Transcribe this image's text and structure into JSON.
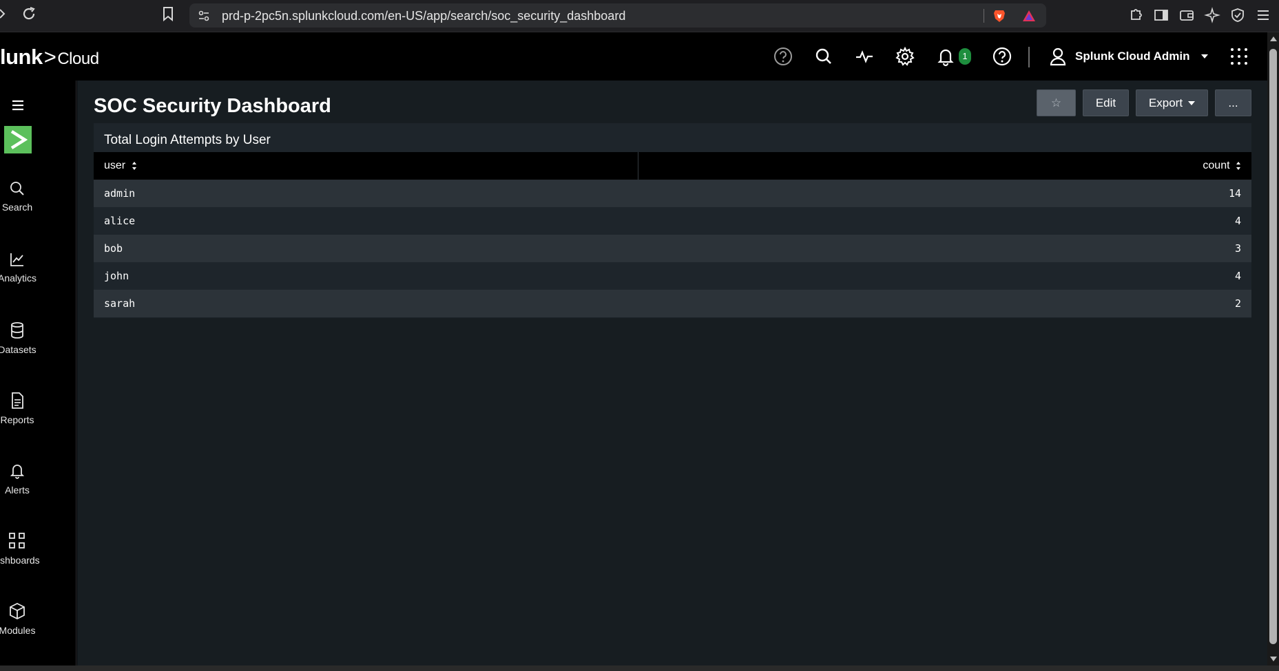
{
  "browser": {
    "url": "prd-p-2pc5n.splunkcloud.com/en-US/app/search/soc_security_dashboard"
  },
  "header": {
    "brand_main": "lunk",
    "brand_sep": ">",
    "brand_sub": "Cloud",
    "notification_count": "1",
    "user_name": "Splunk Cloud Admin"
  },
  "sidebar": {
    "items": [
      {
        "label": "Search",
        "icon": "search-icon"
      },
      {
        "label": "Analytics",
        "icon": "chart-icon"
      },
      {
        "label": "Datasets",
        "icon": "database-icon"
      },
      {
        "label": "Reports",
        "icon": "document-icon"
      },
      {
        "label": "Alerts",
        "icon": "bell-icon"
      },
      {
        "label": "ashboards",
        "icon": "dashboard-grid-icon"
      },
      {
        "label": "Modules",
        "icon": "cube-icon"
      }
    ]
  },
  "dashboard": {
    "title": "SOC Security Dashboard",
    "star_label": "☆",
    "edit_label": "Edit",
    "export_label": "Export",
    "more_label": "...",
    "panel": {
      "title": "Total Login Attempts by User",
      "columns": [
        "user",
        "count"
      ],
      "rows": [
        {
          "user": "admin",
          "count": "14"
        },
        {
          "user": "alice",
          "count": "4"
        },
        {
          "user": "bob",
          "count": "3"
        },
        {
          "user": "john",
          "count": "4"
        },
        {
          "user": "sarah",
          "count": "2"
        }
      ]
    }
  },
  "colors": {
    "accent_green": "#5cc05c",
    "badge_green": "#1e8e3e",
    "background": "#171d21",
    "row_stripe": "#2c3339"
  }
}
